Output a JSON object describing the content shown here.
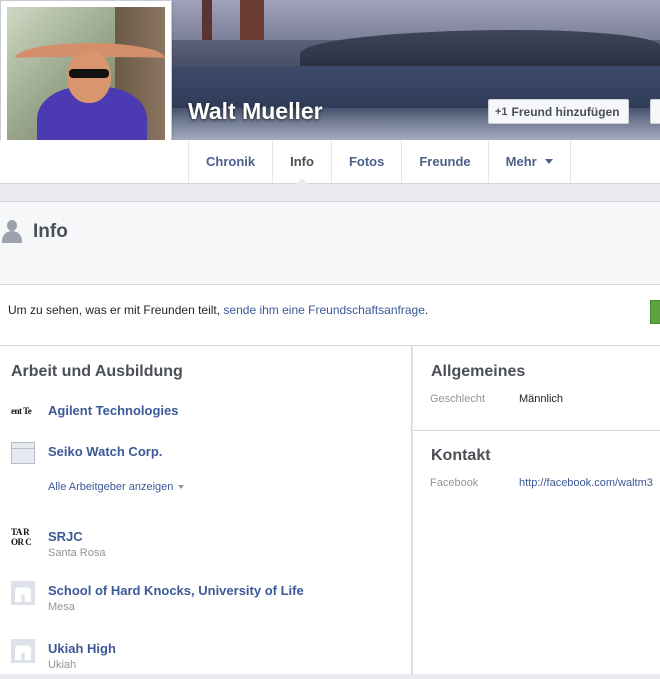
{
  "profile": {
    "name": "Walt Mueller",
    "add_friend_label": "Freund hinzufügen",
    "add_friend_icon": "+1"
  },
  "tabs": [
    {
      "label": "Chronik"
    },
    {
      "label": "Info"
    },
    {
      "label": "Fotos"
    },
    {
      "label": "Freunde"
    },
    {
      "label": "Mehr"
    }
  ],
  "info": {
    "title": "Info"
  },
  "notice": {
    "prefix": "Um zu sehen, was er mit Freunden teilt, ",
    "link": "sende ihm eine Freundschaftsanfrage",
    "suffix": "."
  },
  "work_education": {
    "title": "Arbeit und Ausbildung",
    "employers": [
      {
        "name": "Agilent Technologies",
        "logo_text": "ent Te"
      },
      {
        "name": "Seiko Watch Corp."
      }
    ],
    "show_all_employers": "Alle Arbeitgeber anzeigen",
    "schools": [
      {
        "name": "SRJC",
        "location": "Santa Rosa",
        "logo_text_1": "TA R",
        "logo_text_2": "OR C"
      },
      {
        "name": "School of Hard Knocks, University of Life",
        "location": "Mesa"
      },
      {
        "name": "Ukiah High",
        "location": "Ukiah"
      }
    ]
  },
  "general": {
    "title": "Allgemeines",
    "gender_label": "Geschlecht",
    "gender_value": "Männlich"
  },
  "contact": {
    "title": "Kontakt",
    "facebook_label": "Facebook",
    "facebook_value": "http://facebook.com/waltm3"
  },
  "colors": {
    "link": "#3b5998",
    "background": "#e9eaed",
    "accent_green": "#5fa040"
  }
}
